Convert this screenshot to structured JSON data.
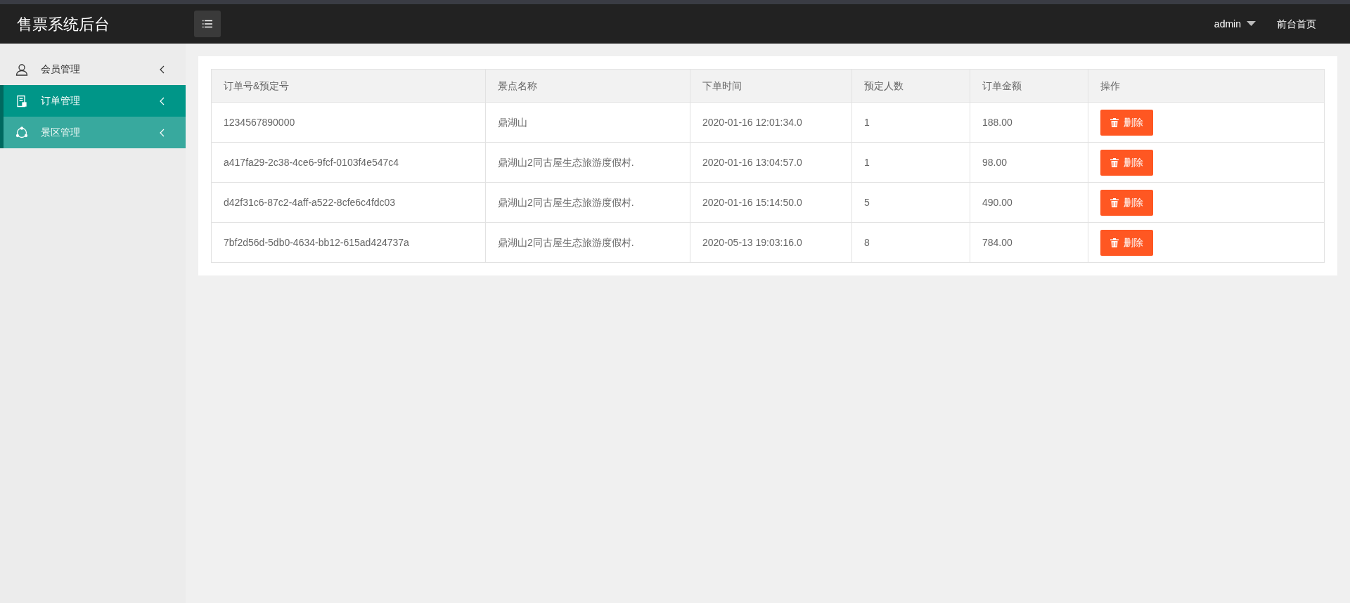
{
  "header": {
    "title": "售票系统后台",
    "user": "admin",
    "home_link": "前台首页"
  },
  "sidebar": {
    "items": [
      {
        "label": "会员管理",
        "kind": "user",
        "selected": false,
        "hovered": false
      },
      {
        "label": "订单管理",
        "kind": "order",
        "selected": true,
        "hovered": false
      },
      {
        "label": "景区管理",
        "kind": "scenic",
        "selected": false,
        "hovered": true
      }
    ]
  },
  "table": {
    "columns": [
      "订单号&预定号",
      "景点名称",
      "下单时间",
      "预定人数",
      "订单金额",
      "操作"
    ],
    "rows": [
      {
        "cells": [
          "1234567890000",
          "鼎湖山",
          "2020-01-16 12:01:34.0",
          "1",
          "188.00"
        ],
        "action": "删除"
      },
      {
        "cells": [
          "a417fa29-2c38-4ce6-9fcf-0103f4e547c4",
          "鼎湖山2同古屋生态旅游度假村.",
          "2020-01-16 13:04:57.0",
          "1",
          "98.00"
        ],
        "action": "删除"
      },
      {
        "cells": [
          "d42f31c6-87c2-4aff-a522-8cfe6c4fdc03",
          "鼎湖山2同古屋生态旅游度假村.",
          "2020-01-16 15:14:50.0",
          "5",
          "490.00"
        ],
        "action": "删除"
      },
      {
        "cells": [
          "7bf2d56d-5db0-4634-bb12-615ad424737a",
          "鼎湖山2同古屋生态旅游度假村.",
          "2020-05-13 19:03:16.0",
          "8",
          "784.00"
        ],
        "action": "删除"
      }
    ]
  }
}
